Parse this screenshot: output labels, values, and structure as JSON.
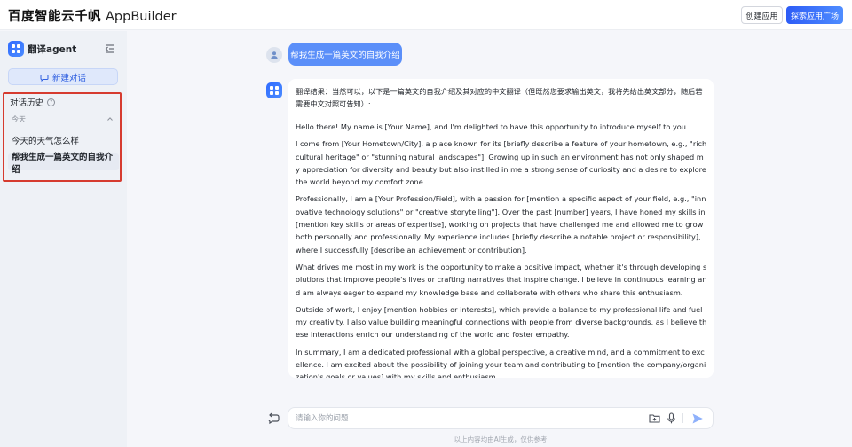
{
  "header": {
    "brand_cn": "百度智能云千帆",
    "brand_en": "AppBuilder",
    "create_app_label": "创建应用",
    "explore_label": "探索应用广场"
  },
  "sidebar": {
    "agent_name": "翻译agent",
    "new_chat_label": "新建对话",
    "history_title": "对话历史",
    "today_label": "今天",
    "history_items": [
      "今天的天气怎么样",
      "帮我生成一篇英文的自我介绍"
    ]
  },
  "chat": {
    "user_message": "帮我生成一篇英文的自我介绍",
    "answer_head": "翻译结果：当然可以，以下是一篇英文的自我介绍及其对应的中文翻译（但既然您要求输出英文，我将先给出英文部分，随后若需要中文对照可告知）:",
    "answer_paragraphs": [
      "Hello there! My name is [Your Name], and I'm delighted to have this opportunity to introduce myself to you.",
      "I come from [Your Hometown/City], a place known for its [briefly describe a feature of your hometown, e.g., \"rich cultural heritage\" or \"stunning natural landscapes\"]. Growing up in such an environment has not only shaped my appreciation for diversity and beauty but also instilled in me a strong sense of curiosity and a desire to explore the world beyond my comfort zone.",
      "Professionally, I am a [Your Profession/Field], with a passion for [mention a specific aspect of your field, e.g., \"innovative technology solutions\" or \"creative storytelling\"]. Over the past [number] years, I have honed my skills in [mention key skills or areas of expertise], working on projects that have challenged me and allowed me to grow both personally and professionally. My experience includes [briefly describe a notable project or responsibility], where I successfully [describe an achievement or contribution].",
      "What drives me most in my work is the opportunity to make a positive impact, whether it's through developing solutions that improve people's lives or crafting narratives that inspire change. I believe in continuous learning and am always eager to expand my knowledge base and collaborate with others who share this enthusiasm.",
      "Outside of work, I enjoy [mention hobbies or interests], which provide a balance to my professional life and fuel my creativity. I also value building meaningful connections with people from diverse backgrounds, as I believe these interactions enrich our understanding of the world and foster empathy.",
      "In summary, I am a dedicated professional with a global perspective, a creative mind, and a commitment to excellence. I am excited about the possibility of joining your team and contributing to [mention the company/organization's goals or values] with my skills and enthusiasm."
    ]
  },
  "input": {
    "placeholder": "请输入你的问题"
  },
  "footer": {
    "note": "以上内容均由AI生成，仅供参考"
  },
  "colors": {
    "accent": "#5b8ff9",
    "highlight_border": "#d63b2f"
  }
}
